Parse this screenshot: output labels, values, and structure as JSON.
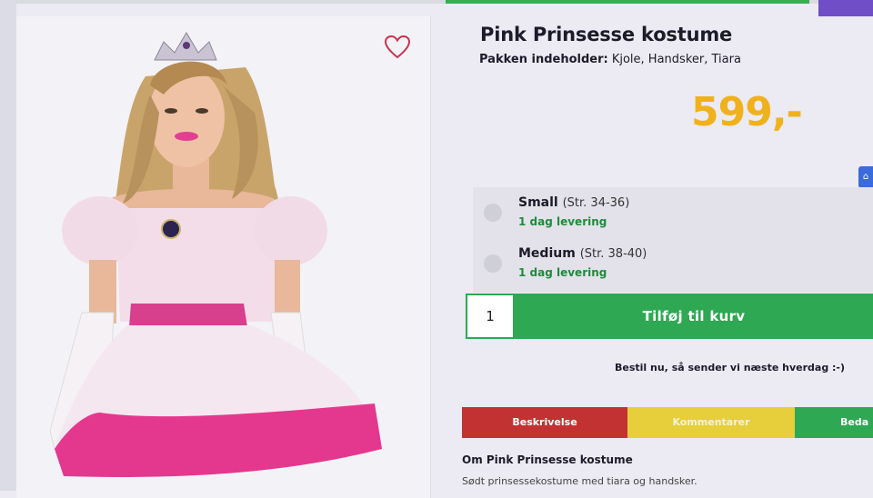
{
  "product": {
    "title": "Pink Prinsesse kostume",
    "contents_label": "Pakken indeholder:",
    "contents_value": "Kjole, Handsker, Tiara",
    "price": "599,-"
  },
  "sizes": [
    {
      "name": "Small",
      "range": "(Str. 34-36)",
      "delivery": "1 dag levering"
    },
    {
      "name": "Medium",
      "range": "(Str. 38-40)",
      "delivery": "1 dag levering"
    }
  ],
  "cart": {
    "quantity": "1",
    "add_label": "Tilføj til kurv",
    "note": "Bestil nu, så sender vi næste hverdag :-)"
  },
  "tabs": [
    {
      "label": "Beskrivelse"
    },
    {
      "label": "Kommentarer"
    },
    {
      "label": "Beda"
    }
  ],
  "about": {
    "title": "Om Pink Prinsesse kostume",
    "text": "Sødt prinsessekostume med tiara og handsker."
  },
  "colors": {
    "price": "#f0b21c",
    "cart_green": "#2ea853",
    "tab_red": "#c33232",
    "tab_yellow": "#e6cf3a",
    "tab_green": "#2ea853",
    "delivery_green": "#1e8c3b"
  },
  "icons": {
    "favorite": "heart-icon",
    "radio": "radio-circle"
  }
}
